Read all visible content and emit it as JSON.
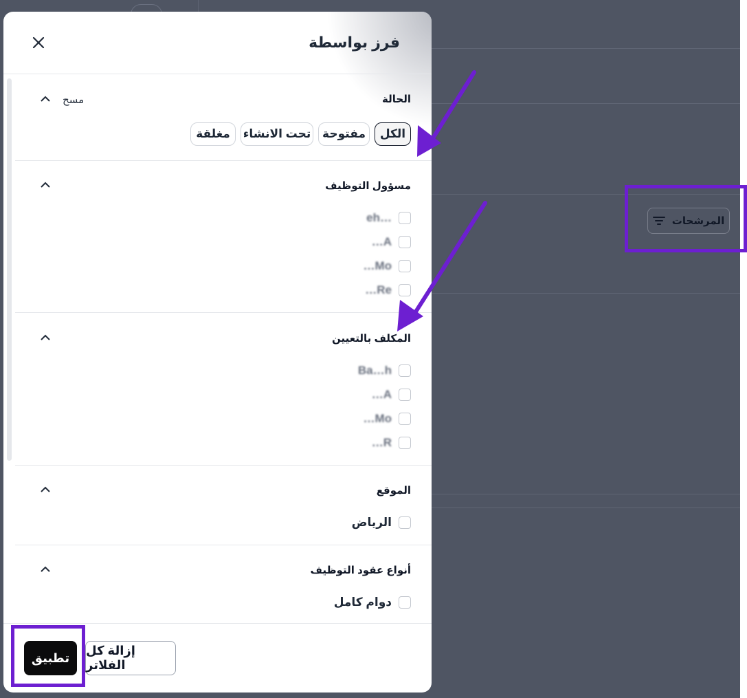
{
  "background": {
    "filters_button_label": "المرشحات",
    "filter_icon": "filter-lines-icon"
  },
  "panel": {
    "title": "فرز بواسطة",
    "close_icon": "close-icon",
    "status": {
      "label": "الحالة",
      "clear": "مسح",
      "chips": [
        "الكل",
        "مفتوحة",
        "تحت الانشاء",
        "مغلقة"
      ]
    },
    "recruiter": {
      "label": "مسؤول التوظيف",
      "options": [
        "…eh",
        "A…",
        "Mo…",
        "Re…"
      ]
    },
    "assignee": {
      "label": "المكلف بالتعيين",
      "options": [
        "Ba…h",
        "A…",
        "Mo…",
        "R…"
      ]
    },
    "location": {
      "label": "الموقع",
      "options": [
        "الرياض"
      ]
    },
    "contract": {
      "label": "أنواع عقود التوظيف",
      "options": [
        "دوام كامل"
      ]
    },
    "footer": {
      "apply": "تطبيق",
      "clear_all": "إزالة كل الفلاتر"
    }
  },
  "colors": {
    "highlight": "#6d1fd1",
    "overlay": "#4f5563",
    "primary_button": "#0b0b0c"
  }
}
